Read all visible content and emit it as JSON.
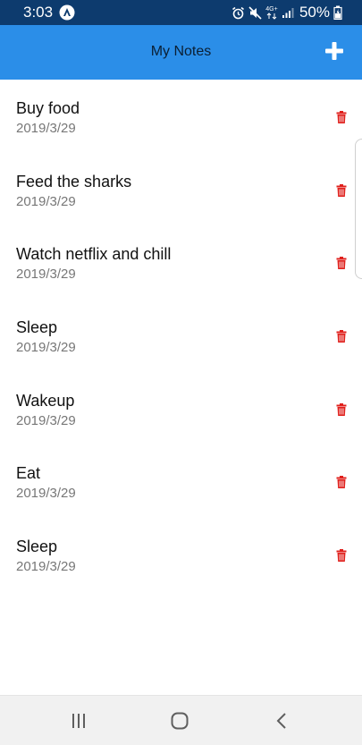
{
  "status_bar": {
    "time": "3:03",
    "network": "4G+",
    "battery": "50%",
    "icons": [
      "app-notification-icon",
      "alarm-icon",
      "mute-icon",
      "network-4g-icon",
      "signal-icon",
      "battery-icon"
    ]
  },
  "app_bar": {
    "title": "My Notes",
    "add_icon": "plus-icon",
    "color": "#2b8ee8"
  },
  "notes": [
    {
      "title": "Buy food",
      "date": "2019/3/29"
    },
    {
      "title": "Feed the sharks",
      "date": "2019/3/29"
    },
    {
      "title": "Watch netflix and chill",
      "date": "2019/3/29"
    },
    {
      "title": "Sleep",
      "date": "2019/3/29"
    },
    {
      "title": "Wakeup",
      "date": "2019/3/29"
    },
    {
      "title": "Eat",
      "date": "2019/3/29"
    },
    {
      "title": "Sleep",
      "date": "2019/3/29"
    }
  ],
  "delete_icon": "trash-icon",
  "delete_color": "#e0201c",
  "nav_bar": {
    "icons": [
      "recents-icon",
      "home-icon",
      "back-icon"
    ]
  }
}
